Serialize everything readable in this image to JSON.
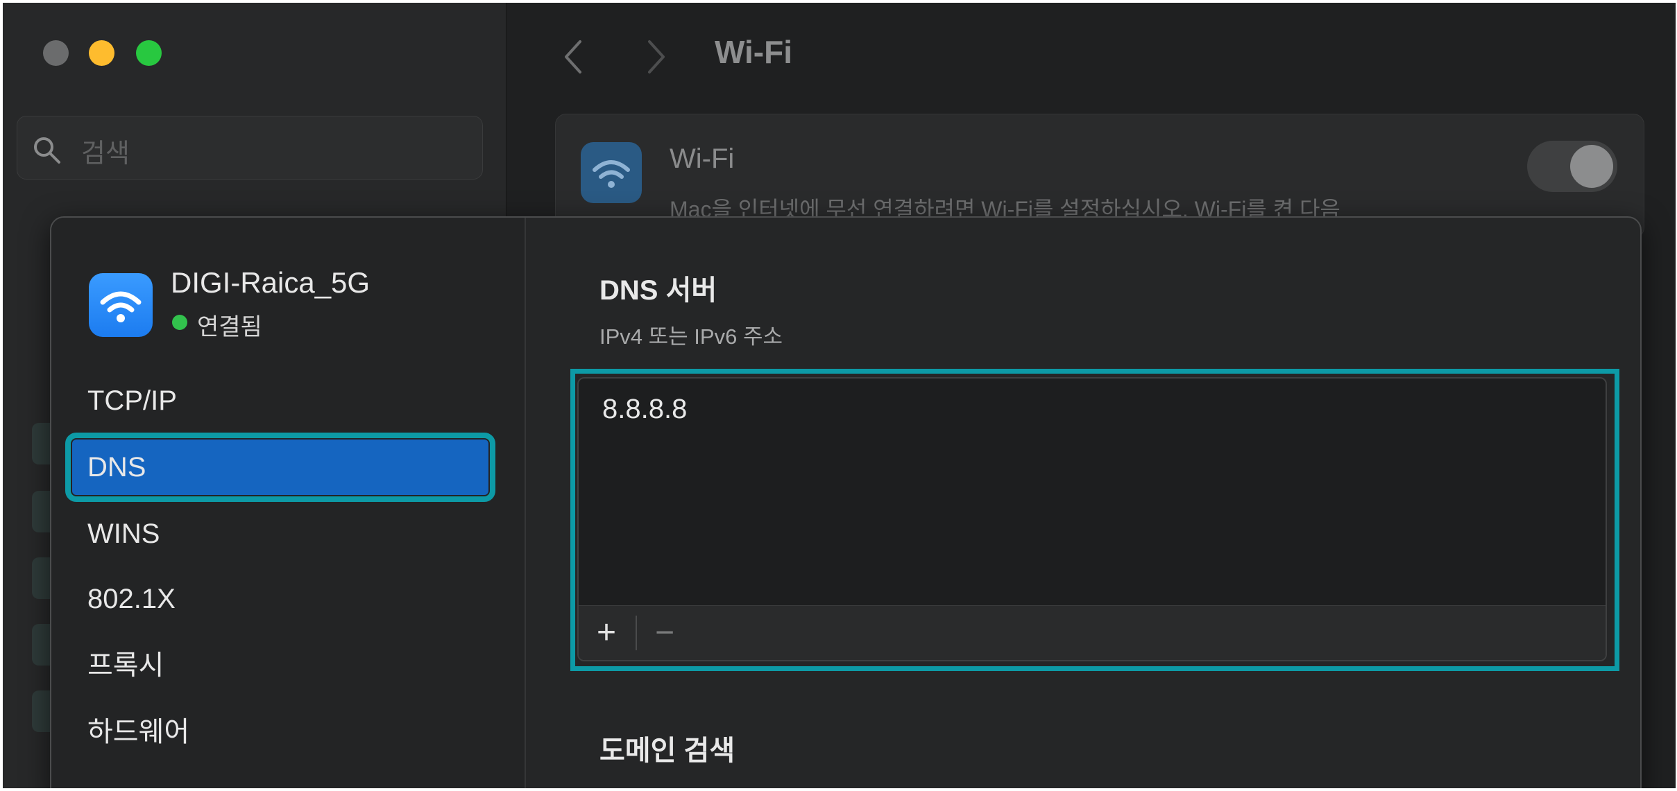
{
  "background": {
    "search_placeholder": "검색",
    "title": "Wi-Fi",
    "wifi_card": {
      "title": "Wi-Fi",
      "subtitle": "Mac을 인터넷에 무선 연결하려면 Wi-Fi를 설정하십시오. Wi-Fi를 켠 다음"
    }
  },
  "network": {
    "name": "DIGI-Raica_5G",
    "status": "연결됨",
    "status_color": "#32c24d"
  },
  "nav": {
    "items": [
      {
        "label": "TCP/IP"
      },
      {
        "label": "DNS"
      },
      {
        "label": "WINS"
      },
      {
        "label": "802.1X"
      },
      {
        "label": "프록시"
      },
      {
        "label": "하드웨어"
      }
    ],
    "selected": "DNS"
  },
  "dns": {
    "title": "DNS 서버",
    "subtitle": "IPv4 또는 IPv6 주소",
    "servers": [
      "8.8.8.8"
    ],
    "add_label": "+",
    "remove_label": "−"
  },
  "domain": {
    "title": "도메인 검색"
  },
  "colors": {
    "accent": "#1565c0",
    "highlight": "#0d9aa6",
    "close": "#6b6c6d",
    "minimize": "#febc2e",
    "maximize": "#28c840"
  },
  "icons": [
    "search-icon",
    "chevron-left-icon",
    "chevron-right-icon",
    "wifi-icon"
  ]
}
